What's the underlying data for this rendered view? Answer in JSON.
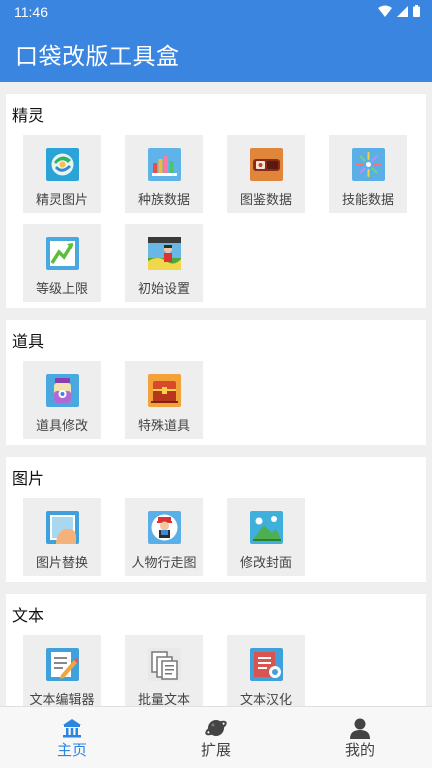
{
  "status_bar": {
    "time": "11:46",
    "icons": [
      "wifi-icon",
      "signal-icon",
      "battery-icon"
    ]
  },
  "app_bar": {
    "title": "口袋改版工具盒"
  },
  "sections": {
    "sprite": {
      "title": "精灵",
      "items": [
        {
          "label": "精灵图片",
          "icon": "sprite-image-icon"
        },
        {
          "label": "种族数据",
          "icon": "bar-chart-icon"
        },
        {
          "label": "图鉴数据",
          "icon": "pokedex-icon"
        },
        {
          "label": "技能数据",
          "icon": "sparkle-icon"
        },
        {
          "label": "等级上限",
          "icon": "level-up-icon"
        },
        {
          "label": "初始设置",
          "icon": "trainer-scene-icon"
        }
      ]
    },
    "items": {
      "title": "道具",
      "items": [
        {
          "label": "道具修改",
          "icon": "potion-icon"
        },
        {
          "label": "特殊道具",
          "icon": "treasure-chest-icon"
        }
      ]
    },
    "images": {
      "title": "图片",
      "items": [
        {
          "label": "图片替换",
          "icon": "image-replace-icon"
        },
        {
          "label": "人物行走图",
          "icon": "character-sprite-icon"
        },
        {
          "label": "修改封面",
          "icon": "landscape-icon"
        }
      ]
    },
    "text": {
      "title": "文本",
      "items": [
        {
          "label": "文本编辑器",
          "icon": "text-editor-icon"
        },
        {
          "label": "批量文本",
          "icon": "batch-text-icon"
        },
        {
          "label": "文本汉化",
          "icon": "text-localize-icon"
        }
      ]
    }
  },
  "bottom_nav": {
    "items": [
      {
        "label": "主页",
        "icon": "home-icon",
        "active": true
      },
      {
        "label": "扩展",
        "icon": "planet-icon",
        "active": false
      },
      {
        "label": "我的",
        "icon": "person-icon",
        "active": false
      }
    ]
  },
  "colors": {
    "primary": "#3a85e0",
    "nav_active": "#2a86e0",
    "tile_bg": "#eeeeee"
  }
}
